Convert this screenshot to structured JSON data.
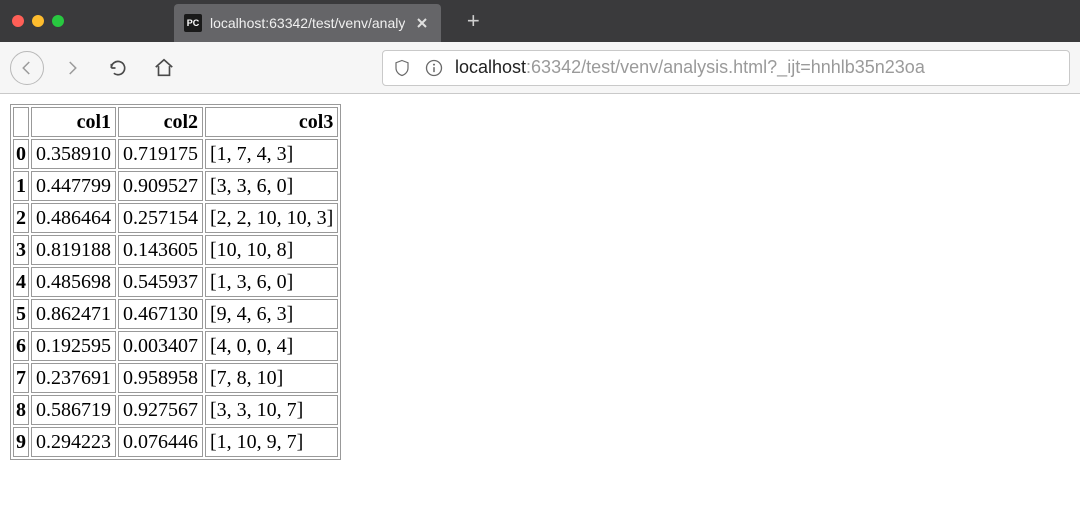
{
  "window": {
    "tab": {
      "favicon_label": "PC",
      "title": "localhost:63342/test/venv/analy"
    },
    "new_tab_label": "+"
  },
  "address": {
    "host": "localhost",
    "port_and_path": ":63342/test/venv/analysis.html?_ijt=hnhlb35n23oa"
  },
  "table": {
    "columns": [
      "col1",
      "col2",
      "col3"
    ],
    "rows": [
      {
        "idx": "0",
        "col1": "0.358910",
        "col2": "0.719175",
        "col3": "[1, 7, 4, 3]"
      },
      {
        "idx": "1",
        "col1": "0.447799",
        "col2": "0.909527",
        "col3": "[3, 3, 6, 0]"
      },
      {
        "idx": "2",
        "col1": "0.486464",
        "col2": "0.257154",
        "col3": "[2, 2, 10, 10, 3]"
      },
      {
        "idx": "3",
        "col1": "0.819188",
        "col2": "0.143605",
        "col3": "[10, 10, 8]"
      },
      {
        "idx": "4",
        "col1": "0.485698",
        "col2": "0.545937",
        "col3": "[1, 3, 6, 0]"
      },
      {
        "idx": "5",
        "col1": "0.862471",
        "col2": "0.467130",
        "col3": "[9, 4, 6, 3]"
      },
      {
        "idx": "6",
        "col1": "0.192595",
        "col2": "0.003407",
        "col3": "[4, 0, 0, 4]"
      },
      {
        "idx": "7",
        "col1": "0.237691",
        "col2": "0.958958",
        "col3": "[7, 8, 10]"
      },
      {
        "idx": "8",
        "col1": "0.586719",
        "col2": "0.927567",
        "col3": "[3, 3, 10, 7]"
      },
      {
        "idx": "9",
        "col1": "0.294223",
        "col2": "0.076446",
        "col3": "[1, 10, 9, 7]"
      }
    ]
  }
}
